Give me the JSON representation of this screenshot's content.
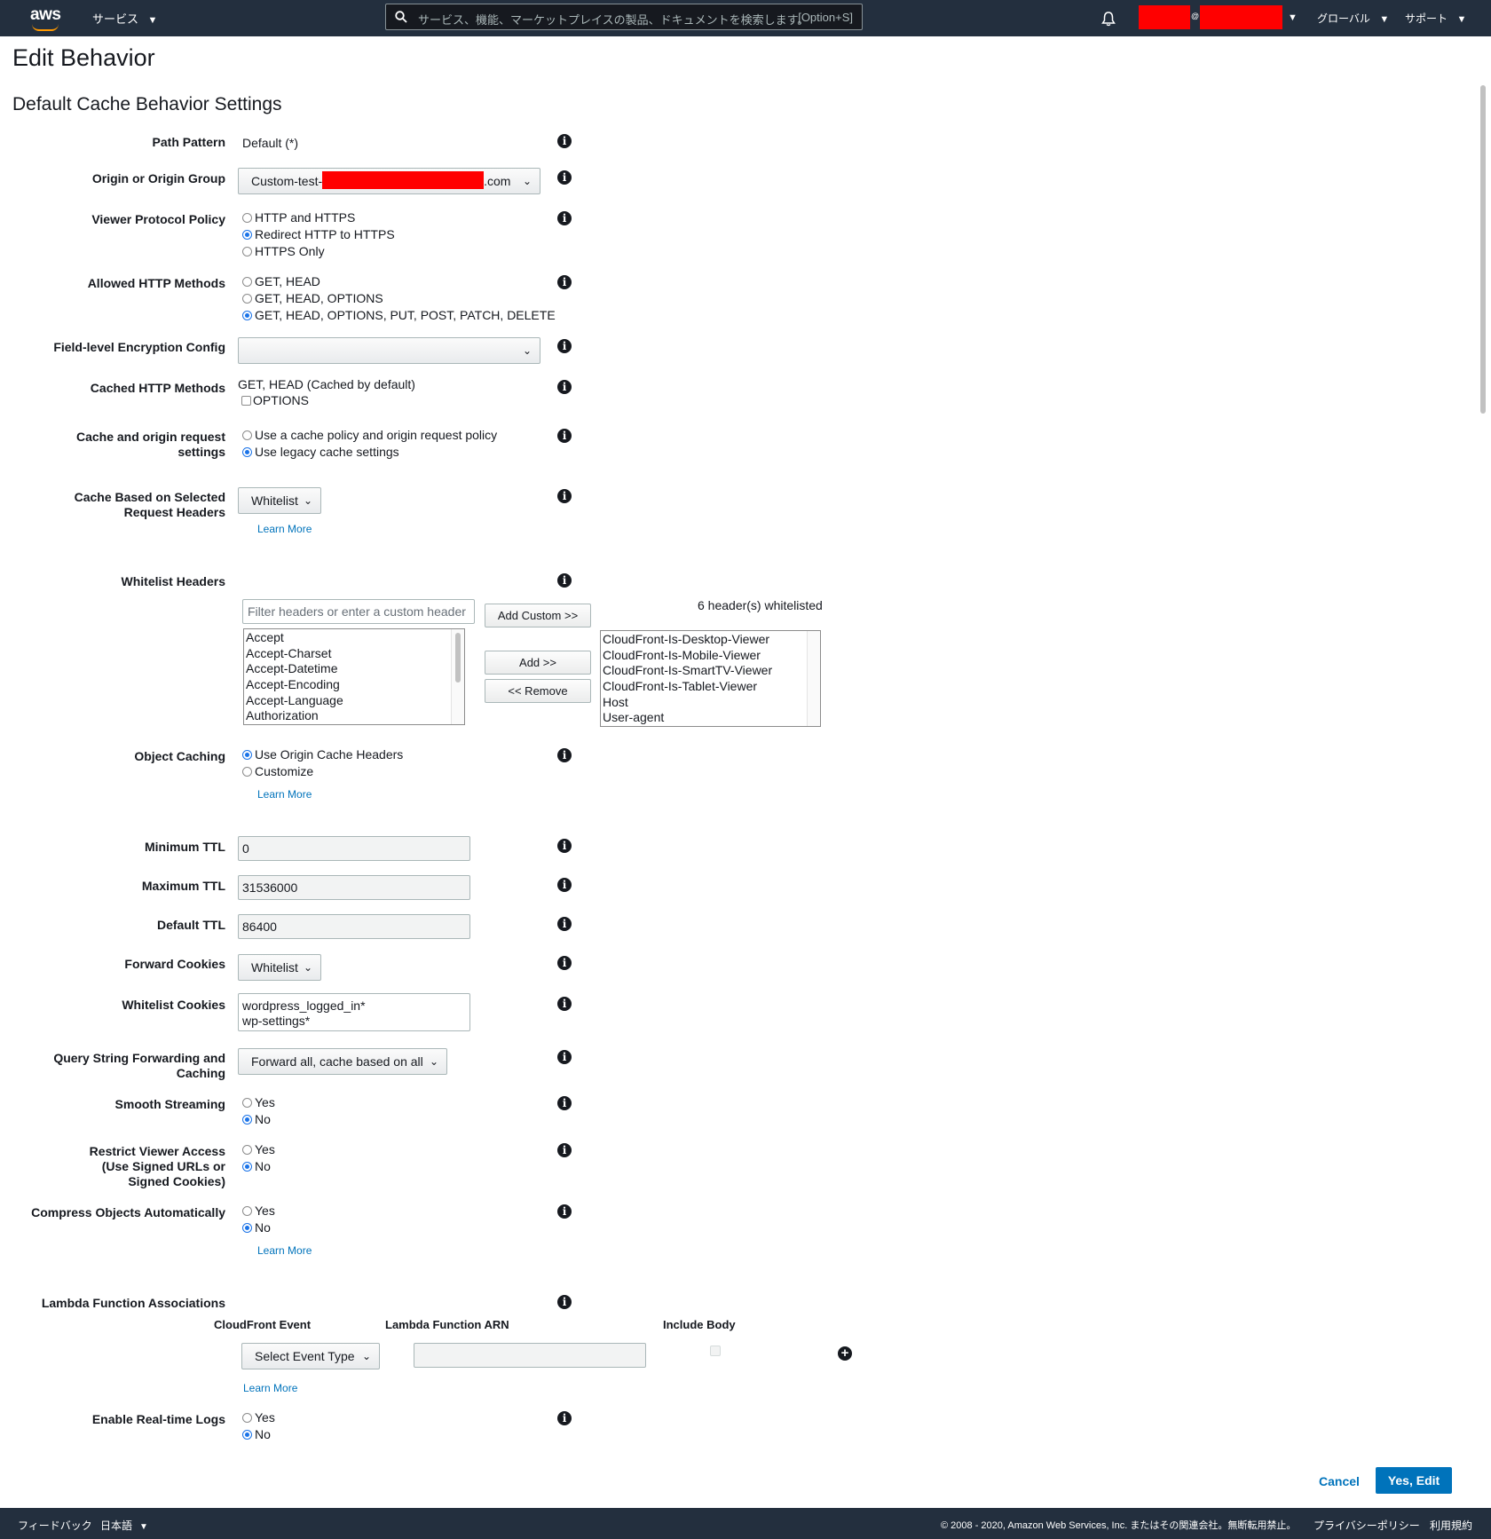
{
  "topnav": {
    "logo": "aws",
    "services_label": "サービス",
    "search_placeholder": "サービス、機能、マーケットプレイスの製品、ドキュメントを検索します。",
    "search_shortcut": "[Option+S]",
    "account_at": "@",
    "region_label": "グローバル",
    "support_label": "サポート",
    "icons": {
      "search": "search-icon",
      "bell": "bell-icon",
      "caret": "caret-down-icon"
    }
  },
  "page": {
    "title": "Edit Behavior",
    "section_title": "Default Cache Behavior Settings"
  },
  "form": {
    "path_pattern": {
      "label": "Path Pattern",
      "value": "Default (*)"
    },
    "origin": {
      "label": "Origin or Origin Group",
      "prefix": "Custom-test-",
      "suffix": ".com"
    },
    "viewer_protocol": {
      "label": "Viewer Protocol Policy",
      "options": [
        "HTTP and HTTPS",
        "Redirect HTTP to HTTPS",
        "HTTPS Only"
      ],
      "selected": "Redirect HTTP to HTTPS"
    },
    "allowed_methods": {
      "label": "Allowed HTTP Methods",
      "options": [
        "GET, HEAD",
        "GET, HEAD, OPTIONS",
        "GET, HEAD, OPTIONS, PUT, POST, PATCH, DELETE"
      ],
      "selected": "GET, HEAD, OPTIONS, PUT, POST, PATCH, DELETE"
    },
    "fle_config": {
      "label": "Field-level Encryption Config",
      "value": ""
    },
    "cached_methods": {
      "label": "Cached HTTP Methods",
      "text": "GET, HEAD (Cached by default)",
      "option": "OPTIONS",
      "checked": false
    },
    "cache_origin_settings": {
      "label_line1": "Cache and origin request",
      "label_line2": "settings",
      "options": [
        "Use a cache policy and origin request policy",
        "Use legacy cache settings"
      ],
      "selected": "Use legacy cache settings"
    },
    "cache_headers": {
      "label_line1": "Cache Based on Selected",
      "label_line2": "Request Headers",
      "value": "Whitelist",
      "learn_more": "Learn More"
    },
    "whitelist_headers": {
      "label": "Whitelist Headers",
      "filter_placeholder": "Filter headers or enter a custom header",
      "add_custom": "Add Custom >>",
      "add": "Add >>",
      "remove": "<< Remove",
      "count_text": "6 header(s) whitelisted",
      "available": [
        "Accept",
        "Accept-Charset",
        "Accept-Datetime",
        "Accept-Encoding",
        "Accept-Language",
        "Authorization"
      ],
      "selected": [
        "CloudFront-Is-Desktop-Viewer",
        "CloudFront-Is-Mobile-Viewer",
        "CloudFront-Is-SmartTV-Viewer",
        "CloudFront-Is-Tablet-Viewer",
        "Host",
        "User-agent"
      ]
    },
    "object_caching": {
      "label": "Object Caching",
      "options": [
        "Use Origin Cache Headers",
        "Customize"
      ],
      "selected": "Use Origin Cache Headers",
      "learn_more": "Learn More"
    },
    "min_ttl": {
      "label": "Minimum TTL",
      "value": "0"
    },
    "max_ttl": {
      "label": "Maximum TTL",
      "value": "31536000"
    },
    "default_ttl": {
      "label": "Default TTL",
      "value": "86400"
    },
    "forward_cookies": {
      "label": "Forward Cookies",
      "value": "Whitelist"
    },
    "whitelist_cookies": {
      "label": "Whitelist Cookies",
      "line1": "wordpress_logged_in*",
      "line2": "wp-settings*"
    },
    "query_string": {
      "label_line1": "Query String Forwarding and",
      "label_line2": "Caching",
      "value": "Forward all, cache based on all"
    },
    "smooth_streaming": {
      "label": "Smooth Streaming",
      "yes": "Yes",
      "no": "No",
      "selected": "No"
    },
    "restrict_viewer": {
      "label_line1": "Restrict Viewer Access",
      "label_line2": "(Use Signed URLs or",
      "label_line3": "Signed Cookies)",
      "yes": "Yes",
      "no": "No",
      "selected": "No"
    },
    "compress": {
      "label": "Compress Objects Automatically",
      "yes": "Yes",
      "no": "No",
      "selected": "No",
      "learn_more": "Learn More"
    },
    "lambda": {
      "label": "Lambda Function Associations",
      "col_event": "CloudFront Event",
      "col_arn": "Lambda Function ARN",
      "col_body": "Include Body",
      "event_select": "Select Event Type",
      "arn_value": "",
      "learn_more": "Learn More"
    },
    "realtime_logs": {
      "label": "Enable Real-time Logs",
      "yes": "Yes",
      "no": "No",
      "selected": "No"
    }
  },
  "actions": {
    "cancel": "Cancel",
    "submit": "Yes, Edit"
  },
  "footer": {
    "feedback": "フィードバック",
    "language": "日本語",
    "copyright": "© 2008 - 2020, Amazon Web Services, Inc. またはその関連会社。無断転用禁止。",
    "privacy": "プライバシーポリシー",
    "terms": "利用規約"
  },
  "colors": {
    "nav_bg": "#232f3e",
    "accent": "#ff9900",
    "link": "#0073bb",
    "primary_btn": "#0073bb",
    "redaction": "#ff0000"
  }
}
